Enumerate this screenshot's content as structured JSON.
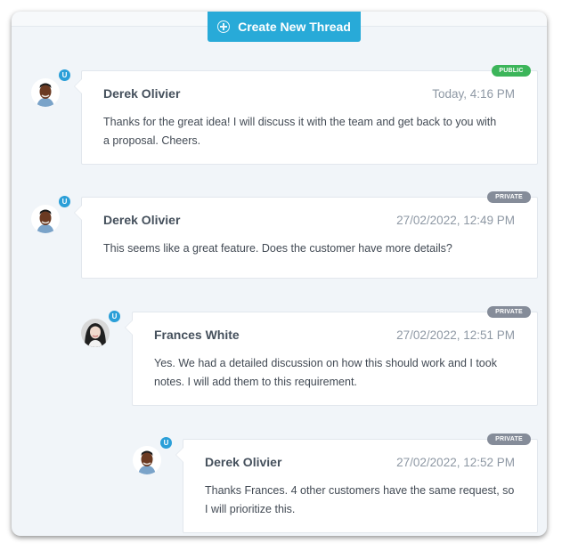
{
  "toolbar": {
    "create_label": "Create New Thread"
  },
  "colors": {
    "accent": "#28aad8",
    "public": "#3cb55a",
    "private": "#858c99",
    "user_badge": "#2b9fd8"
  },
  "threads": [
    {
      "author": "Derek Olivier",
      "time": "Today,  4:16 PM",
      "visibility": "PUBLIC",
      "badge": "U",
      "lines": [
        "Thanks for the great idea! I will discuss it with the team and get back to you with",
        "a proposal. Cheers."
      ]
    },
    {
      "author": "Derek Olivier",
      "time": "27/02/2022,  12:49 PM",
      "visibility": "PRIVATE",
      "badge": "U",
      "lines": [
        "This seems like a great feature. Does the customer have more details?"
      ]
    },
    {
      "author": "Frances White",
      "time": "27/02/2022,  12:51 PM",
      "visibility": "PRIVATE",
      "badge": "U",
      "lines": [
        "Yes. We had a detailed discussion on how this should work and I took",
        "notes. I will add them to this requirement."
      ]
    },
    {
      "author": "Derek Olivier",
      "time": "27/02/2022,  12:52 PM",
      "visibility": "PRIVATE",
      "badge": "U",
      "lines": [
        "Thanks Frances. 4 other customers have the same request, so",
        "I will prioritize this."
      ]
    }
  ]
}
